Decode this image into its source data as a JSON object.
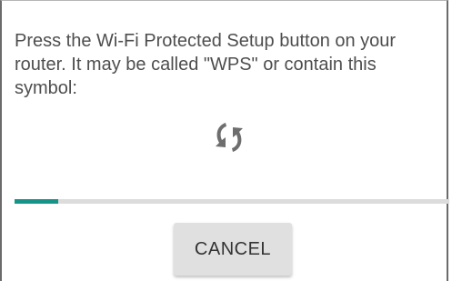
{
  "dialog": {
    "message": "Press the Wi-Fi Protected Setup button on your router. It may be called \"WPS\" or contain this symbol:",
    "icon": "wps-icon",
    "progress": 0.1,
    "cancel_label": "CANCEL"
  },
  "colors": {
    "text": "#4e4e4e",
    "icon": "#6e6e6e",
    "progress_fill": "#169487",
    "progress_track": "#dcdcdc",
    "button_bg": "#e0e0e0"
  }
}
